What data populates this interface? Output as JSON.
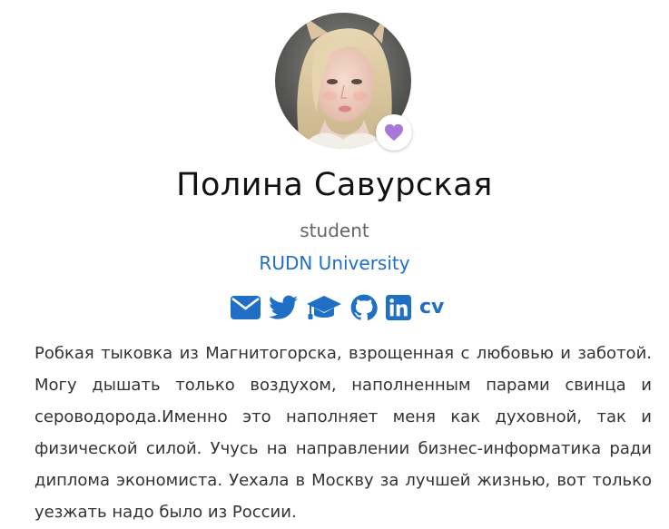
{
  "profile": {
    "name": "Полина Савурская",
    "role": "student",
    "organization": "RUDN University",
    "status_icon": "purple-heart",
    "accent_color": "#1f6fc5",
    "heart_color": "#a678d8"
  },
  "social": [
    {
      "name": "email-icon",
      "label": "email"
    },
    {
      "name": "twitter-icon",
      "label": "twitter"
    },
    {
      "name": "graduation-cap-icon",
      "label": "google scholar"
    },
    {
      "name": "github-icon",
      "label": "github"
    },
    {
      "name": "linkedin-icon",
      "label": "linkedin"
    }
  ],
  "cv_label": "cv",
  "bio": "Робкая тыковка из Магнитогорска, взрощенная с любовью и заботой. Могу дышать только воздухом, наполненным парами свинца и сероводорода.Именно это наполняет меня как духовной, так и физической силой. Учусь на направлении бизнес-информатика ради диплома экономиста. Уехала в Москву за лучшей жизнью, вот только уезжать надо было из России."
}
